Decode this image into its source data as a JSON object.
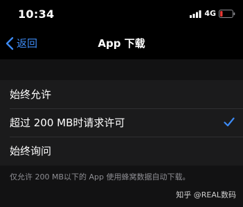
{
  "status_bar": {
    "time": "10:34",
    "network": "4G",
    "battery_color": "#e53935"
  },
  "nav": {
    "back_label": "返回",
    "title": "App 下载",
    "accent_color": "#3d8bf5"
  },
  "options": [
    {
      "label": "始终允许",
      "selected": false
    },
    {
      "label": "超过 200 MB时请求许可",
      "selected": true
    },
    {
      "label": "始终询问",
      "selected": false
    }
  ],
  "footer": {
    "note": "仅允许 200 MB以下的 App 使用蜂窝数据自动下载。"
  },
  "watermark": "知乎 @REAL数码"
}
